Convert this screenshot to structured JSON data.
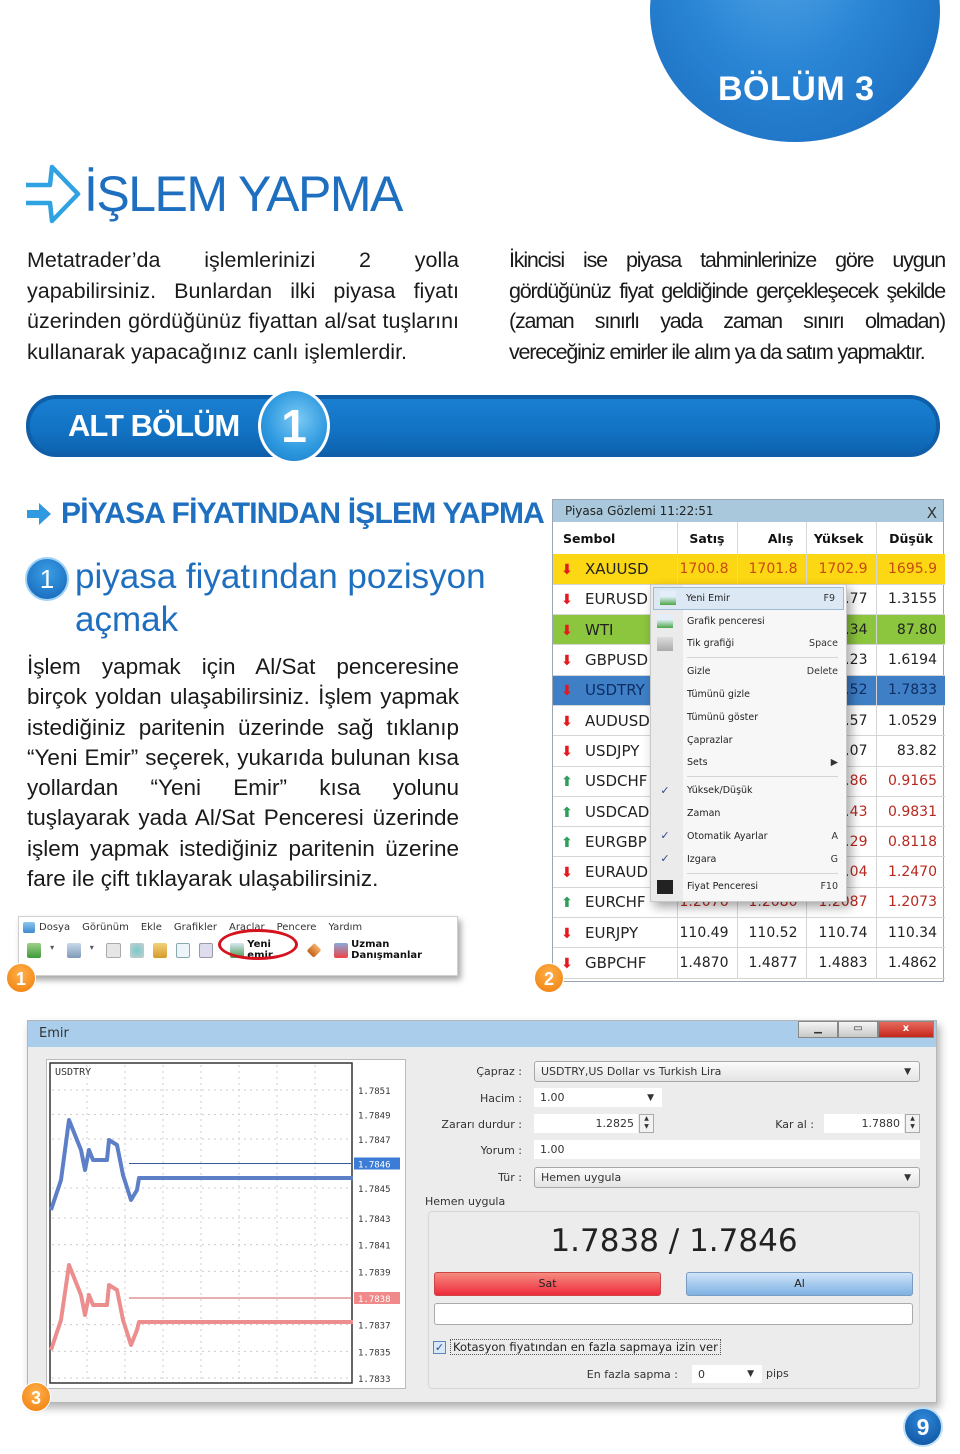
{
  "chapter": {
    "label": "BÖLÜM 3",
    "color": "#2b86d6"
  },
  "title": {
    "text": "İŞLEM YAPMA",
    "color": "#1e6fbf"
  },
  "intro": {
    "left": "Metatrader’da işlemlerinizi 2 yolla yapabilirsiniz. Bunlardan ilki piyasa fiyatı üzerinden gördüğünüz fiyattan al/sat tuşlarını kullanarak yapacağınız canlı işlemlerdir.",
    "right": "İkincisi ise piyasa tahminlerinize göre uygun gördüğünüz fiyat geldiğinde gerçekleşecek şekilde (zaman sınırlı yada zaman sınırı olmadan) vereceğiniz emirler ile alım ya da satım yapmaktır."
  },
  "subsection": {
    "label": "ALT BÖLÜM",
    "number": "1"
  },
  "section_heading": "PİYASA FİYATINDAN İŞLEM YAPMA",
  "step": {
    "number": "1",
    "title": "piyasa fiyatından pozisyon açmak",
    "body": "İşlem yapmak için Al/Sat penceresine birçok yoldan ulaşabilirsiniz. İşlem yapmak istediğiniz paritenin üzerinde sağ tıklanıp “Yeni Emir” seçerek, yukarıda bulunan kısa yollardan “Yeni Emir” kısa yolunu tuşlayarak yada  Al/Sat Penceresi üzerinde işlem yapmak istediğiniz paritenin üzerine fare ile çift tıklayarak ulaşabilirsiniz."
  },
  "screenshot1": {
    "badge": "1",
    "menu": [
      "Dosya",
      "Görünüm",
      "Ekle",
      "Grafikler",
      "Araçlar",
      "Pencere",
      "Yardım"
    ],
    "new_order_label": "Yeni emir",
    "expert_label": "Uzman Danışmanlar"
  },
  "screenshot2": {
    "badge": "2",
    "window_title": "Piyasa Gözlemi 11:22:51",
    "close_label": "X",
    "columns": [
      "Sembol",
      "Satış",
      "Alış",
      "Yüksek",
      "Düşük"
    ],
    "rows": [
      {
        "symbol": "XAUUSD",
        "dir": "down",
        "bid": "1700.8",
        "ask": "1701.8",
        "high": "1702.9",
        "low": "1695.9",
        "style": "yellow"
      },
      {
        "symbol": "EURUSD",
        "dir": "down",
        "bid": "",
        "ask": "",
        "high": "…77",
        "low": "1.3155",
        "style": ""
      },
      {
        "symbol": "WTI",
        "dir": "down",
        "bid": "",
        "ask": "",
        "high": "…34",
        "low": "87.80",
        "style": "green"
      },
      {
        "symbol": "GBPUSD",
        "dir": "down",
        "bid": "",
        "ask": "",
        "high": "…23",
        "low": "1.6194",
        "style": ""
      },
      {
        "symbol": "USDTRY",
        "dir": "down",
        "bid": "",
        "ask": "",
        "high": "…52",
        "low": "1.7833",
        "style": "blue"
      },
      {
        "symbol": "AUDUSD",
        "dir": "down",
        "bid": "",
        "ask": "",
        "high": "…57",
        "low": "1.0529",
        "style": ""
      },
      {
        "symbol": "USDJPY",
        "dir": "down",
        "bid": "",
        "ask": "",
        "high": "…07",
        "low": "83.82",
        "style": ""
      },
      {
        "symbol": "USDCHF",
        "dir": "up",
        "bid": "",
        "ask": "",
        "high": "…86",
        "low": "0.9165",
        "style": "red"
      },
      {
        "symbol": "USDCAD",
        "dir": "up",
        "bid": "",
        "ask": "",
        "high": "…43",
        "low": "0.9831",
        "style": "red"
      },
      {
        "symbol": "EURGBP",
        "dir": "up",
        "bid": "",
        "ask": "",
        "high": "…29",
        "low": "0.8118",
        "style": "red"
      },
      {
        "symbol": "EURAUD",
        "dir": "down",
        "bid": "",
        "ask": "",
        "high": "…04",
        "low": "1.2470",
        "style": "red"
      },
      {
        "symbol": "EURCHF",
        "dir": "up",
        "bid": "1.2076",
        "ask": "1.2080",
        "high": "1.2087",
        "low": "1.2073",
        "style": "red"
      },
      {
        "symbol": "EURJPY",
        "dir": "down",
        "bid": "110.49",
        "ask": "110.52",
        "high": "110.74",
        "low": "110.34",
        "style": ""
      },
      {
        "symbol": "GBPCHF",
        "dir": "down",
        "bid": "1.4870",
        "ask": "1.4877",
        "high": "1.4883",
        "low": "1.4862",
        "style": ""
      }
    ],
    "context_menu": [
      {
        "label": "Yeni Emir",
        "key": "F9",
        "icon": "new-order",
        "highlighted": true
      },
      {
        "label": "Grafik penceresi",
        "key": "",
        "icon": "chart-window"
      },
      {
        "label": "Tik grafiği",
        "key": "Space",
        "icon": "tick-chart"
      },
      {
        "sep": true
      },
      {
        "label": "Gizle",
        "key": "Delete"
      },
      {
        "label": "Tümünü gizle",
        "key": ""
      },
      {
        "label": "Tümünü göster",
        "key": ""
      },
      {
        "label": "Çaprazlar",
        "key": ""
      },
      {
        "label": "Sets",
        "key": "▶"
      },
      {
        "sep": true
      },
      {
        "label": "Yüksek/Düşük",
        "key": "",
        "checked": true
      },
      {
        "label": "Zaman",
        "key": ""
      },
      {
        "label": "Otomatik Ayarlar",
        "key": "A",
        "checked": true
      },
      {
        "label": "Izgara",
        "key": "G",
        "checked": true
      },
      {
        "sep": true
      },
      {
        "label": "Fiyat Penceresi",
        "key": "F10",
        "icon": "price-window"
      }
    ]
  },
  "screenshot3": {
    "badge": "3",
    "window_title": "Emir",
    "chart": {
      "symbol": "USDTRY",
      "ask_ticks": [
        "1.7851",
        "1.7849",
        "1.7847",
        "1.7846",
        "1.7845"
      ],
      "bid_ticks": [
        "1.7843",
        "1.7841",
        "1.7839",
        "1.7838",
        "1.7837",
        "1.7835",
        "1.7833"
      ],
      "ask_current": "1.7846",
      "bid_current": "1.7838"
    },
    "form": {
      "symbol_label": "Çapraz :",
      "symbol_value": "USDTRY,US Dollar vs Turkish Lira",
      "volume_label": "Hacim :",
      "volume_value": "1.00",
      "sl_label": "Zararı durdur :",
      "sl_value": "1.2825",
      "tp_label": "Kar al :",
      "tp_value": "1.7880",
      "comment_label": "Yorum :",
      "comment_value": "1.00",
      "type_label": "Tür :",
      "type_value": "Hemen uygula"
    },
    "group_label": "Hemen uygula",
    "price": "1.7838 / 1.7846",
    "sell_label": "Sat",
    "buy_label": "Al",
    "deviation_checkbox": "Kotasyon fiyatından en fazla sapmaya izin ver",
    "deviation_checked": true,
    "max_dev_label": "En fazla sapma :",
    "max_dev_value": "0",
    "max_dev_unit": "pips"
  },
  "page_number": "9"
}
